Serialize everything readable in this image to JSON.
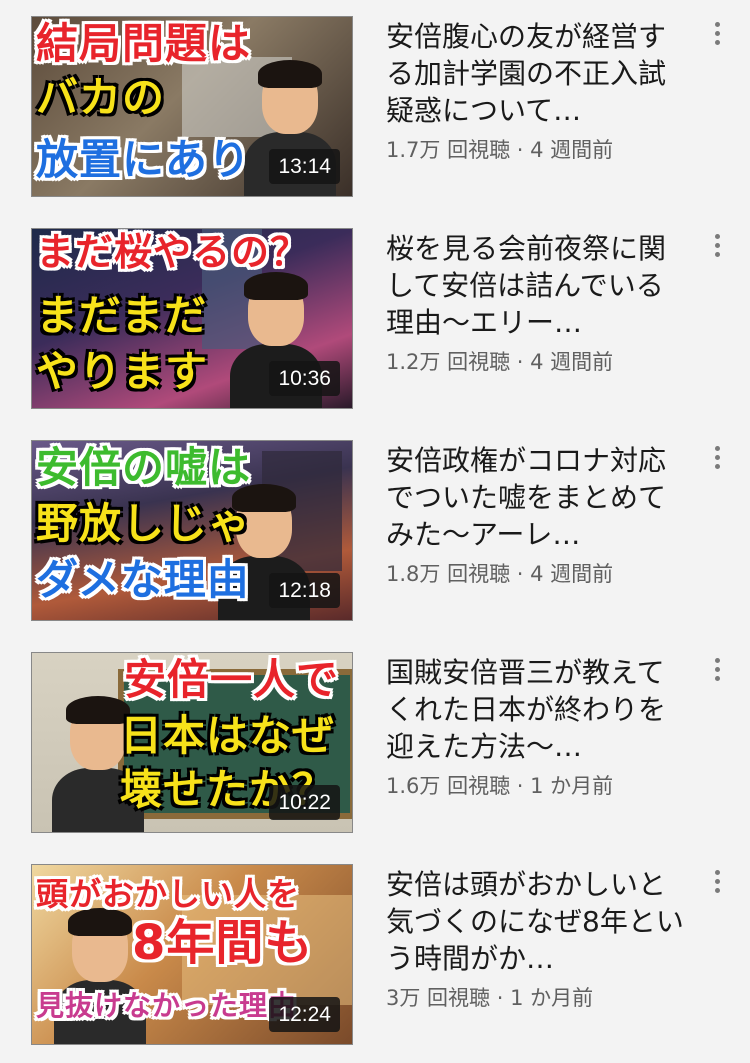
{
  "videos": [
    {
      "title": "安倍腹心の友が経営する加計学園の不正入試疑惑について…",
      "views": "1.7万 回視聴",
      "age": "4 週間前",
      "duration": "13:14",
      "thumb_text": [
        "結局問題は",
        "バカの",
        "放置にあり"
      ],
      "thumb_colors": [
        "#e8242b",
        "#f7e21a",
        "#1e6fe0"
      ]
    },
    {
      "title": "桜を見る会前夜祭に関して安倍は詰んでいる理由〜エリー…",
      "views": "1.2万 回視聴",
      "age": "4 週間前",
      "duration": "10:36",
      "thumb_text": [
        "まだ桜やるの？",
        "まだまだ",
        "やります"
      ],
      "thumb_colors": [
        "#e8242b",
        "#f7e21a",
        "#f7e21a"
      ]
    },
    {
      "title": "安倍政権がコロナ対応でついた嘘をまとめてみた〜アーレ…",
      "views": "1.8万 回視聴",
      "age": "4 週間前",
      "duration": "12:18",
      "thumb_text": [
        "安倍の嘘は",
        "野放しじゃ",
        "ダメな理由"
      ],
      "thumb_colors": [
        "#3dbb2e",
        "#f7e21a",
        "#1e6fe0"
      ]
    },
    {
      "title": "国賊安倍晋三が教えてくれた日本が終わりを迎えた方法〜…",
      "views": "1.6万 回視聴",
      "age": "1 か月前",
      "duration": "10:22",
      "thumb_text": [
        "安倍一人で",
        "日本はなぜ",
        "壊せたか？"
      ],
      "thumb_colors": [
        "#e8242b",
        "#f7e21a",
        "#f7e21a"
      ]
    },
    {
      "title": "安倍は頭がおかしいと気づくのになぜ8年という時間がか…",
      "views": "3万 回視聴",
      "age": "1 か月前",
      "duration": "12:24",
      "thumb_text": [
        "頭がおかしい人を",
        "8年間も",
        "見抜けなかった理由"
      ],
      "thumb_colors": [
        "#e8242b",
        "#e8242b",
        "#c83b8f"
      ]
    }
  ],
  "separator": " · ",
  "menu_icon": "more-vert-icon"
}
